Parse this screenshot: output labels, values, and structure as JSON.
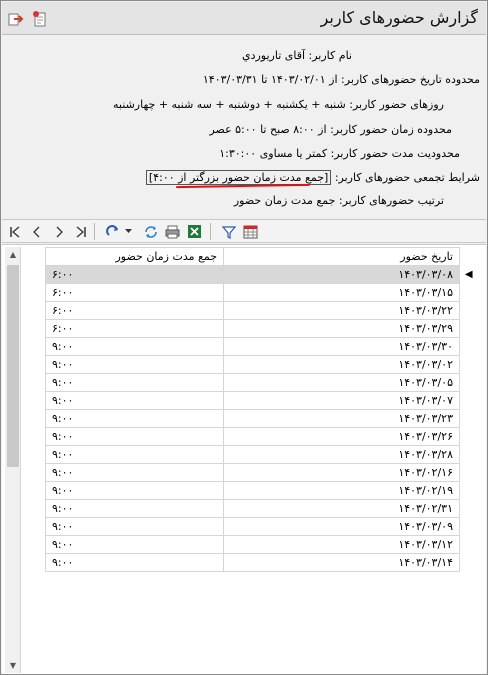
{
  "title": "گزارش حضورهای کاربر",
  "title_icons": [
    "export-icon",
    "new-report-icon"
  ],
  "info": {
    "user": {
      "label": "نام کاربر:",
      "value": "آقای تاریوردي"
    },
    "date_range": {
      "label": "محدوده تاریخ حضورهای کاربر:",
      "value": "از ۱۴۰۳/۰۲/۰۱ تا ۱۴۰۳/۰۳/۳۱"
    },
    "days": {
      "label": "روزهای حضور کاربر:",
      "value": "شنبه + یکشنبه + دوشنبه + سه شنبه + چهارشنبه"
    },
    "time_range": {
      "label": "محدوده زمان حضور کاربر:",
      "value": "از ۸:۰۰ صبح تا ۵:۰۰ عصر"
    },
    "duration_limit": {
      "label": "محدودیت مدت حضور کاربر:",
      "value": "کمتر یا مساوی ۱:۳۰:۰۰"
    },
    "aggregate": {
      "label": "شرایط تجمعی حضورهای کاربر:",
      "value": "[جمع مدت زمان حضور بزرگتر از ۴:۰۰]"
    },
    "sort": {
      "label": "ترتیب حضورهای کاربر:",
      "value": "جمع مدت زمان حضور"
    }
  },
  "toolbar": [
    "first-icon",
    "prev-icon",
    "next-icon",
    "last-icon",
    "redo-icon",
    "dropdown-icon",
    "refresh-icon",
    "print-icon",
    "excel-icon",
    "filter-icon",
    "calendar-grid-icon"
  ],
  "grid": {
    "columns": {
      "date": "تاریخ حضور",
      "total": "جمع مدت زمان حضور"
    },
    "rows": [
      {
        "date": "۱۴۰۳/۰۳/۰۸",
        "total": "۶:۰۰"
      },
      {
        "date": "۱۴۰۳/۰۳/۱۵",
        "total": "۶:۰۰"
      },
      {
        "date": "۱۴۰۳/۰۳/۲۲",
        "total": "۶:۰۰"
      },
      {
        "date": "۱۴۰۳/۰۳/۲۹",
        "total": "۶:۰۰"
      },
      {
        "date": "۱۴۰۳/۰۳/۳۰",
        "total": "۹:۰۰"
      },
      {
        "date": "۱۴۰۳/۰۳/۰۲",
        "total": "۹:۰۰"
      },
      {
        "date": "۱۴۰۳/۰۳/۰۵",
        "total": "۹:۰۰"
      },
      {
        "date": "۱۴۰۳/۰۳/۰۷",
        "total": "۹:۰۰"
      },
      {
        "date": "۱۴۰۳/۰۳/۲۳",
        "total": "۹:۰۰"
      },
      {
        "date": "۱۴۰۳/۰۳/۲۶",
        "total": "۹:۰۰"
      },
      {
        "date": "۱۴۰۳/۰۳/۲۸",
        "total": "۹:۰۰"
      },
      {
        "date": "۱۴۰۳/۰۲/۱۶",
        "total": "۹:۰۰"
      },
      {
        "date": "۱۴۰۳/۰۲/۱۹",
        "total": "۹:۰۰"
      },
      {
        "date": "۱۴۰۳/۰۲/۳۱",
        "total": "۹:۰۰"
      },
      {
        "date": "۱۴۰۳/۰۳/۰۹",
        "total": "۹:۰۰"
      },
      {
        "date": "۱۴۰۳/۰۳/۱۲",
        "total": "۹:۰۰"
      },
      {
        "date": "۱۴۰۳/۰۳/۱۴",
        "total": "۹:۰۰"
      }
    ],
    "selected_index": 0
  },
  "colors": {
    "highlight_underline": "#e01010",
    "selected_row": "#d8d8d8"
  }
}
